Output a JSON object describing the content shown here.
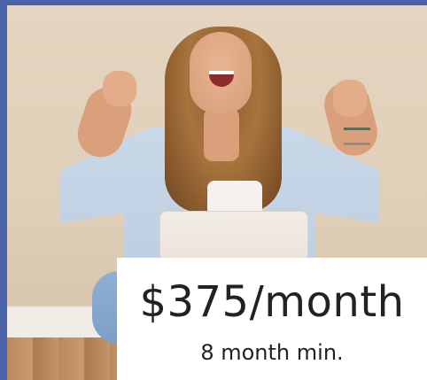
{
  "colors": {
    "frame_border": "#4a63a8",
    "card_background": "#ffffff",
    "text": "#222222"
  },
  "hero_image": {
    "icon": "woman-celebrating-with-laptop-photo"
  },
  "price_card": {
    "price": "$375/month",
    "minimum_term": "8 month min."
  }
}
